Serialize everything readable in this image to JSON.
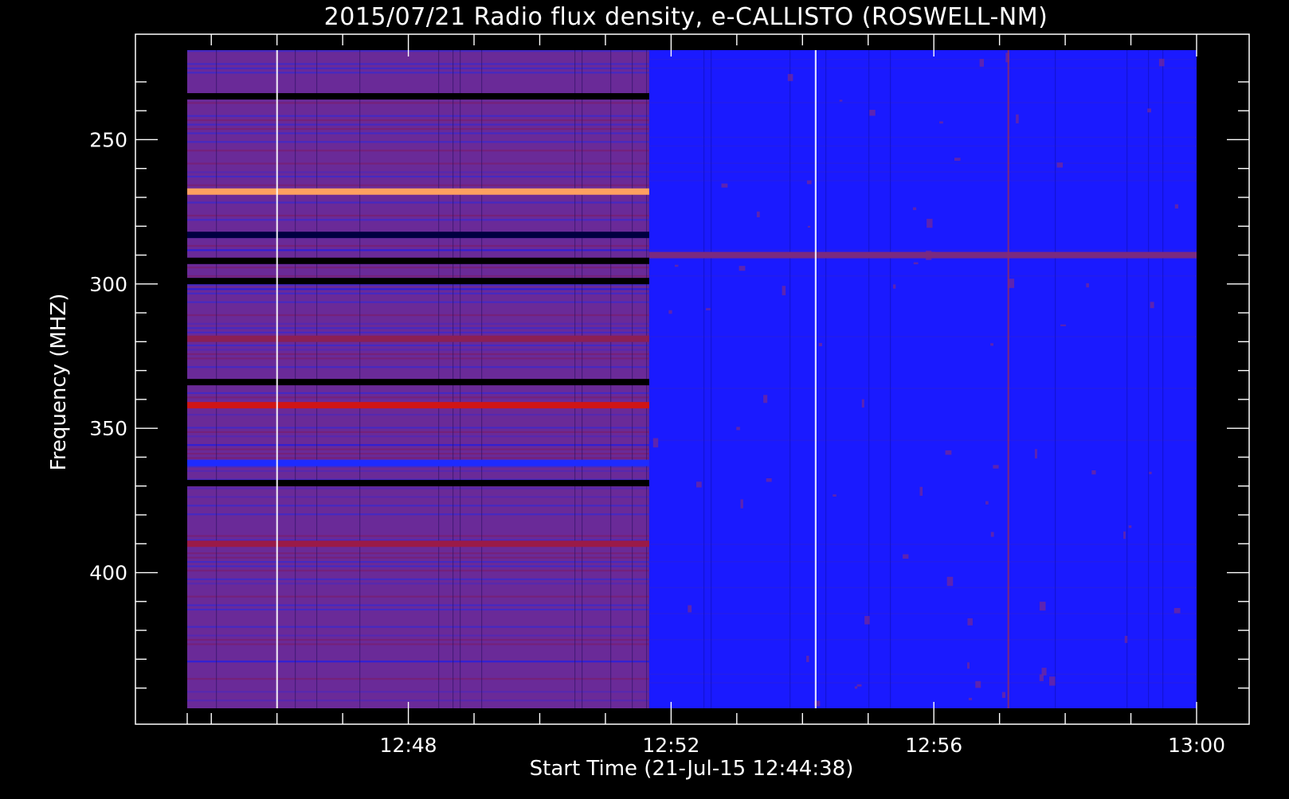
{
  "chart_data": {
    "type": "heatmap",
    "title": "2015/07/21  Radio flux density, e-CALLISTO (ROSWELL-NM)",
    "xlabel": "Start Time (21-Jul-15 12:44:38)",
    "ylabel": "Frequency (MHZ)",
    "x_axis": {
      "type": "time",
      "start": "12:44:38",
      "range": [
        "12:44:38",
        "13:00:00"
      ],
      "major_ticks": [
        "12:48",
        "12:52",
        "12:56",
        "13:00"
      ]
    },
    "y_axis": {
      "range": [
        219,
        447
      ],
      "inverted": true,
      "major_ticks": [
        250,
        300,
        350,
        400
      ]
    },
    "grid": false,
    "colormap": [
      "#000000",
      "#1a1aff",
      "#6a1f8a",
      "#b01030",
      "#ff3a10",
      "#ffa060"
    ],
    "background_color": "#000000",
    "foreground_color": "#ffffff",
    "spectrogram": {
      "regimes": [
        {
          "time_range": [
            "12:44:38",
            "12:51:40"
          ],
          "baseline": "#6a2a98"
        },
        {
          "time_range": [
            "12:51:40",
            "13:00:00"
          ],
          "baseline": "#1a1aff"
        }
      ],
      "horizontal_bands": [
        {
          "freq": 235,
          "time_range": [
            "12:44:38",
            "12:51:40"
          ],
          "color": "#000000"
        },
        {
          "freq": 268,
          "time_range": [
            "12:44:38",
            "12:51:40"
          ],
          "color": "#ffa060"
        },
        {
          "freq": 283,
          "time_range": [
            "12:44:38",
            "12:51:40"
          ],
          "color": "#000040"
        },
        {
          "freq": 292,
          "time_range": [
            "12:44:38",
            "12:51:40"
          ],
          "color": "#000000"
        },
        {
          "freq": 290,
          "time_range": [
            "12:51:40",
            "13:00:00"
          ],
          "color": "#7a2a80"
        },
        {
          "freq": 299,
          "time_range": [
            "12:44:38",
            "12:51:40"
          ],
          "color": "#000000"
        },
        {
          "freq": 319,
          "time_range": [
            "12:44:38",
            "12:51:40"
          ],
          "color": "#8a1f55"
        },
        {
          "freq": 334,
          "time_range": [
            "12:44:38",
            "12:51:40"
          ],
          "color": "#000000"
        },
        {
          "freq": 342,
          "time_range": [
            "12:44:38",
            "12:51:40"
          ],
          "color": "#d01515"
        },
        {
          "freq": 362,
          "time_range": [
            "12:44:38",
            "12:51:40"
          ],
          "color": "#1d2bff"
        },
        {
          "freq": 369,
          "time_range": [
            "12:44:38",
            "12:51:40"
          ],
          "color": "#000000"
        },
        {
          "freq": 390,
          "time_range": [
            "12:44:38",
            "12:51:40"
          ],
          "color": "#9a1a48"
        }
      ],
      "vertical_lines": [
        {
          "time": "12:46:00",
          "color": "#ffffff"
        },
        {
          "time": "12:54:12",
          "color": "#ffffff"
        },
        {
          "time": "12:57:08",
          "color": "#8a2a70"
        }
      ]
    }
  }
}
